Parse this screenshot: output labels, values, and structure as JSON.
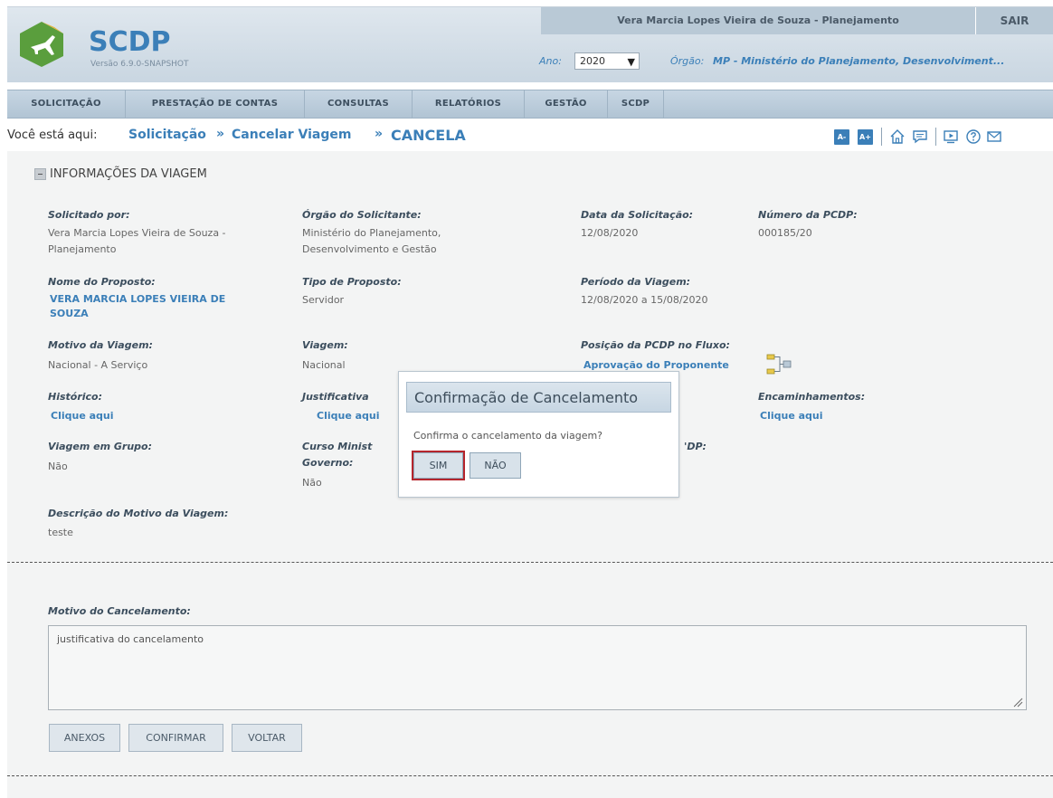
{
  "header": {
    "logo_text": "SCDP",
    "version": "Versão 6.9.0-SNAPSHOT",
    "user_name": "Vera Marcia Lopes Vieira de Souza - Planejamento",
    "logout_label": "SAIR",
    "year_label": "Ano:",
    "year_value": "2020",
    "org_label": "Órgão:",
    "org_value": "MP - Ministério do Planejamento, Desenvolviment..."
  },
  "nav": {
    "items": [
      {
        "label": "SOLICITAÇÃO"
      },
      {
        "label": "PRESTAÇÃO DE CONTAS"
      },
      {
        "label": "CONSULTAS"
      },
      {
        "label": "RELATÓRIOS"
      },
      {
        "label": "GESTÃO"
      },
      {
        "label": "SCDP"
      }
    ]
  },
  "breadcrumb": {
    "prefix": "Você está aqui:",
    "items": [
      "Solicitação",
      "Cancelar Viagem"
    ],
    "current": "CANCELA",
    "separator": "»",
    "font_decrease": "A-",
    "font_increase": "A+"
  },
  "trip": {
    "section_title": "INFORMAÇÕES DA VIAGEM",
    "solicitado_por": {
      "label": "Solicitado por:",
      "value": "Vera Marcia Lopes Vieira de Souza - Planejamento"
    },
    "orgao_solicitante": {
      "label": "Órgão do Solicitante:",
      "value": "Ministério do Planejamento, Desenvolvimento e Gestão"
    },
    "data_solicitacao": {
      "label": "Data da Solicitação:",
      "value": "12/08/2020"
    },
    "numero_pcdp": {
      "label": "Número da PCDP:",
      "value": "000185/20"
    },
    "nome_proposto": {
      "label": "Nome do Proposto:",
      "value": "VERA MARCIA LOPES VIEIRA DE SOUZA"
    },
    "tipo_proposto": {
      "label": "Tipo de Proposto:",
      "value": "Servidor"
    },
    "periodo_viagem": {
      "label": "Período da Viagem:",
      "value": "12/08/2020 a 15/08/2020"
    },
    "motivo_viagem": {
      "label": "Motivo da Viagem:",
      "value": "Nacional - A Serviço"
    },
    "viagem": {
      "label": "Viagem:",
      "value": "Nacional"
    },
    "posicao_fluxo": {
      "label": "Posição da PCDP no Fluxo:",
      "value": "Aprovação do Proponente"
    },
    "historico": {
      "label": "Histórico:",
      "link": "Clique aqui"
    },
    "justificativa": {
      "label": "Justificativa",
      "link": "Clique aqui"
    },
    "encaminhamentos": {
      "label": "Encaminhamentos:",
      "link": "Clique aqui"
    },
    "viagem_grupo": {
      "label": "Viagem em Grupo:",
      "value": "Não"
    },
    "curso": {
      "label_line1": "Curso Minist",
      "label_line2": "Governo:",
      "value": "Não"
    },
    "partial_label": "'DP:",
    "descricao_motivo": {
      "label": "Descrição do Motivo da Viagem:",
      "value": "teste"
    }
  },
  "cancel": {
    "label": "Motivo do Cancelamento:",
    "text": "justificativa do cancelamento",
    "buttons": {
      "anexos": "ANEXOS",
      "confirmar": "CONFIRMAR",
      "voltar": "VOLTAR"
    }
  },
  "modal": {
    "title": "Confirmação de Cancelamento",
    "message": "Confirma o cancelamento da viagem?",
    "yes": "SIM",
    "no": "NÃO"
  },
  "colors": {
    "accent": "#3b7fb8",
    "logo_green": "#5a9e3d",
    "highlight_red": "#b5252c"
  }
}
